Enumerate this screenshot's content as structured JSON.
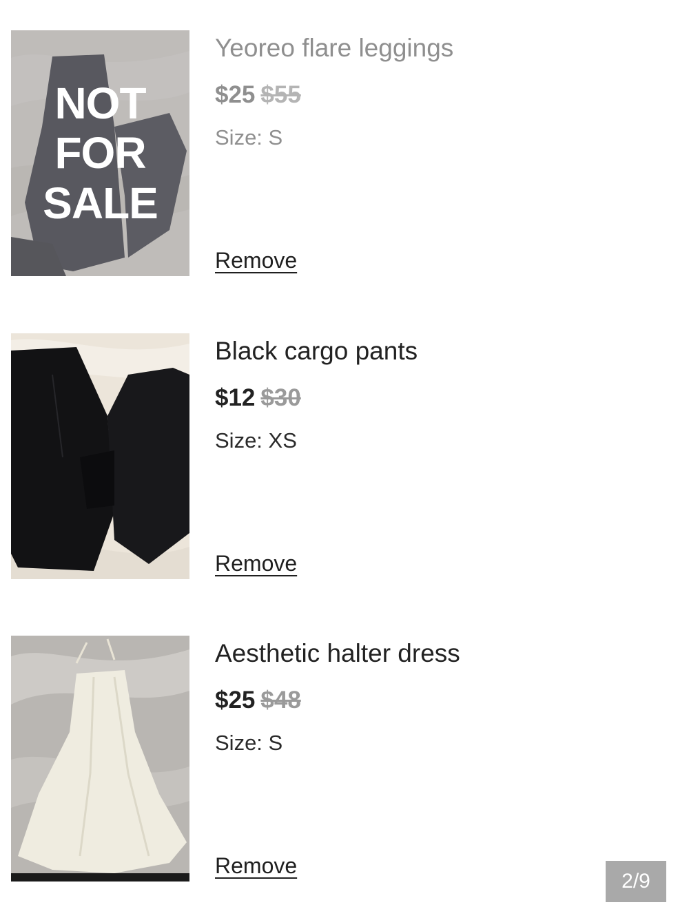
{
  "items": [
    {
      "title": "Yeoreo flare leggings",
      "price": "$25",
      "original_price": "$55",
      "size": "Size: S",
      "remove_label": "Remove",
      "overlay": [
        "NOT",
        "FOR",
        "SALE"
      ],
      "status": "not-for-sale"
    },
    {
      "title": "Black cargo pants",
      "price": "$12",
      "original_price": "$30",
      "size": "Size: XS",
      "remove_label": "Remove"
    },
    {
      "title": "Aesthetic halter dress",
      "price": "$25",
      "original_price": "$48",
      "size": "Size: S",
      "remove_label": "Remove"
    }
  ],
  "pager": {
    "label": "2/9"
  }
}
